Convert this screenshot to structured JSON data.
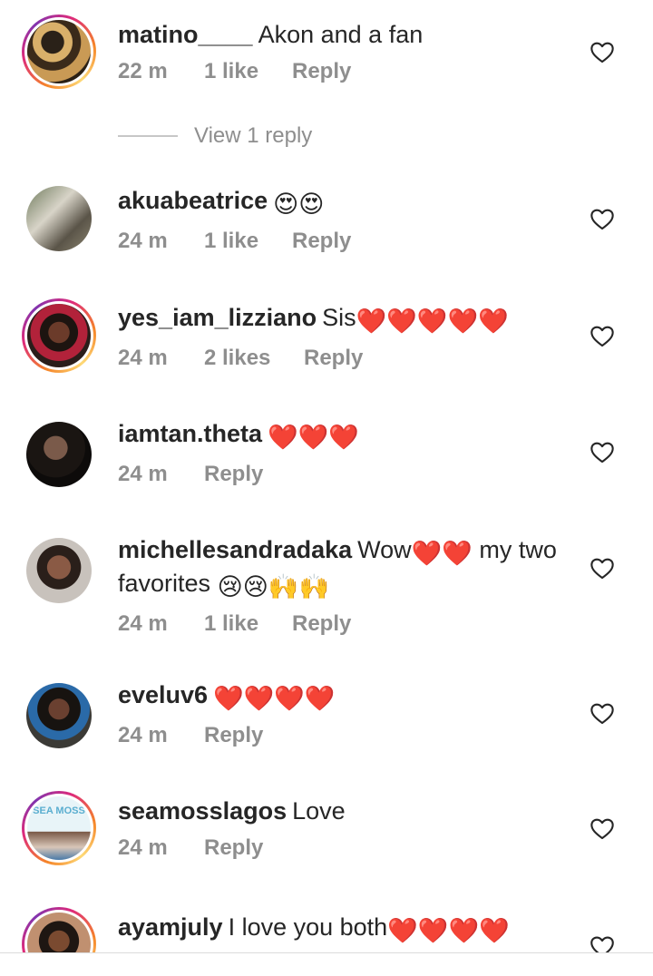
{
  "comments": [
    {
      "username": "matino____",
      "text": "Akon and a fan",
      "emoji": "",
      "time": "22 m",
      "likes": "1 like",
      "reply": "Reply"
    },
    {
      "username": "akuabeatrice",
      "text": "",
      "emoji": "😍😍",
      "time": "24 m",
      "likes": "1 like",
      "reply": "Reply"
    },
    {
      "username": "yes_iam_lizziano",
      "text": "Sis",
      "emoji": "❤️❤️❤️❤️❤️",
      "time": "24 m",
      "likes": "2 likes",
      "reply": "Reply"
    },
    {
      "username": "iamtan.theta",
      "text": "",
      "emoji": "❤️❤️❤️",
      "time": "24 m",
      "likes": "",
      "reply": "Reply"
    },
    {
      "username": "michellesandradaka",
      "text": "Wow",
      "emoji": "❤️❤️",
      "text2": "my two favorites",
      "emoji2": "😢😢🙌🙌",
      "time": "24 m",
      "likes": "1 like",
      "reply": "Reply"
    },
    {
      "username": "eveluv6",
      "text": "",
      "emoji": "❤️❤️❤️❤️",
      "time": "24 m",
      "likes": "",
      "reply": "Reply"
    },
    {
      "username": "seamosslagos",
      "text": "Love",
      "emoji": "",
      "time": "24 m",
      "likes": "",
      "reply": "Reply"
    },
    {
      "username": "ayamjuly",
      "text": "I love you both",
      "emoji": "❤️❤️❤️❤️",
      "time": "",
      "likes": "",
      "reply": ""
    }
  ],
  "view_replies": "View 1 reply",
  "colors": {
    "text": "#262626",
    "meta": "#8e8e8e",
    "heart": "#e0245e"
  },
  "icons": {
    "like": "heart-outline-icon"
  },
  "avatar_logo_text": "SEA MOSS"
}
